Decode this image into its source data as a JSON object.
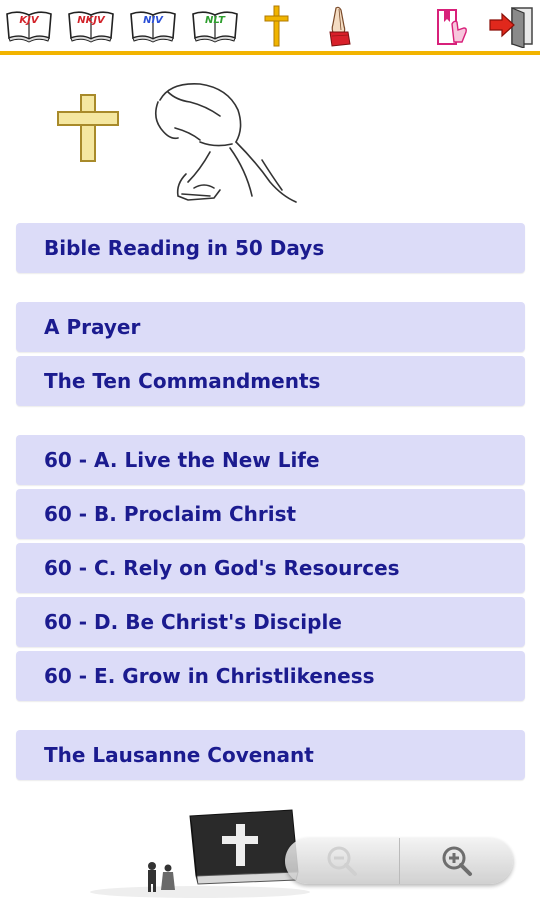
{
  "toolbar": {
    "bibles": [
      {
        "label": "KJV",
        "color": "#d2232a"
      },
      {
        "label": "NKJV",
        "color": "#d2232a"
      },
      {
        "label": "NIV",
        "color": "#2a4fd6"
      },
      {
        "label": "NLT",
        "color": "#2e9e2e"
      }
    ],
    "icons": [
      "cross-icon",
      "praying-hands-icon",
      "bookmark-hand-icon",
      "exit-icon"
    ],
    "accent_color": "#f2b400"
  },
  "menu": {
    "items": [
      "Bible Reading in 50 Days",
      "A Prayer",
      "The Ten Commandments",
      "60 - A. Live the New Life",
      "60 - B. Proclaim Christ",
      "60 - C. Rely on God's Resources",
      "60 - D. Be Christ's Disciple",
      "60 - E. Grow in Christlikeness",
      "The Lausanne Covenant"
    ],
    "item_bg": "#dcdcf8",
    "text_color": "#1b1b8f"
  },
  "zoom": {
    "out_icon": "zoom-out-icon",
    "in_icon": "zoom-in-icon"
  }
}
